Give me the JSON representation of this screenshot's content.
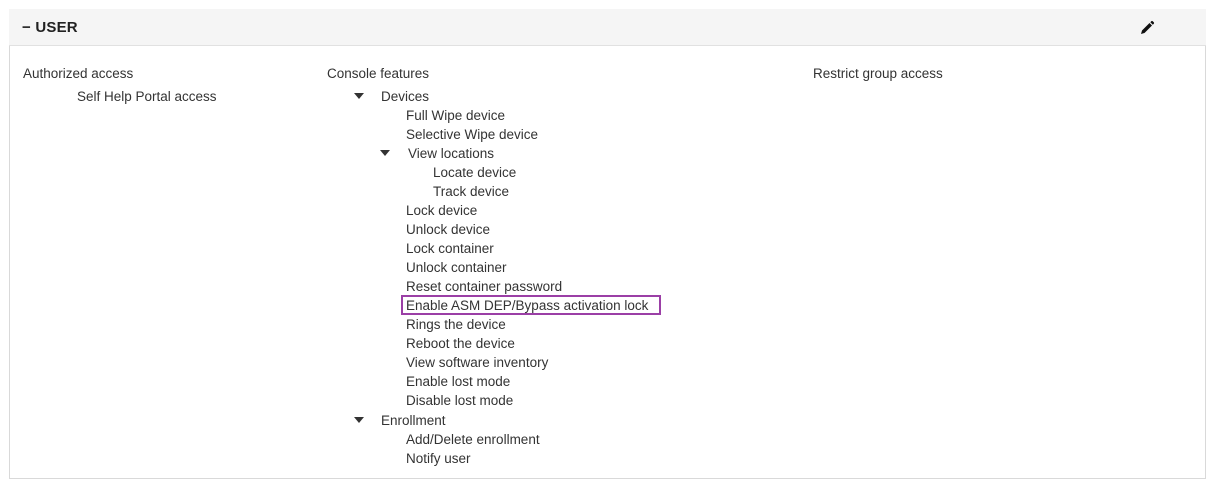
{
  "panel": {
    "title": "− USER",
    "edit_icon": "pencil-icon"
  },
  "columns": {
    "authorized_access": "Authorized access",
    "console_features": "Console features",
    "restrict_group_access": "Restrict group access"
  },
  "authorized_items": [
    "Self Help Portal access"
  ],
  "tree": {
    "devices": "Devices",
    "full_wipe": "Full Wipe device",
    "selective_wipe": "Selective Wipe device",
    "view_locations": "View locations",
    "locate_device": "Locate device",
    "track_device": "Track device",
    "lock_device": "Lock device",
    "unlock_device": "Unlock device",
    "lock_container": "Lock container",
    "unlock_container": "Unlock container",
    "reset_container_password": "Reset container password",
    "enable_asm_dep": "Enable ASM DEP/Bypass activation lock",
    "rings_device": "Rings the device",
    "reboot_device": "Reboot the device",
    "view_software_inventory": "View software inventory",
    "enable_lost_mode": "Enable lost mode",
    "disable_lost_mode": "Disable lost mode",
    "enrollment": "Enrollment",
    "add_delete_enrollment": "Add/Delete enrollment",
    "notify_user": "Notify user"
  },
  "colors": {
    "highlight": "#9b3fa6",
    "header_bg": "#f5f5f5",
    "border": "#d9d9d9"
  }
}
